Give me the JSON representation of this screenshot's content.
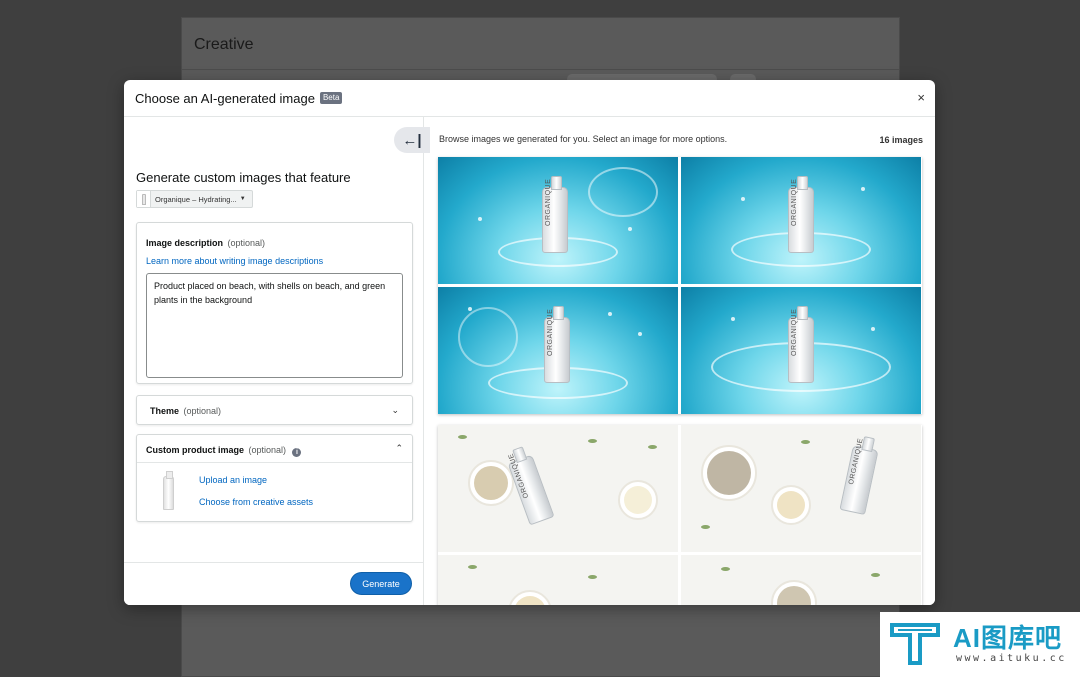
{
  "background": {
    "page_title": "Creative"
  },
  "modal": {
    "title": "Choose an AI-generated image",
    "badge": "Beta",
    "close_label": "×"
  },
  "left": {
    "collapse_label": "←|",
    "heading": "Generate custom images that feature",
    "product_select": "Organique – Hydrating...",
    "description": {
      "label": "Image description",
      "optional": "(optional)",
      "learn_more": "Learn more about writing image descriptions",
      "value": "Product placed on beach, with shells on beach, and green plants in the background"
    },
    "theme": {
      "label": "Theme",
      "optional": "(optional)"
    },
    "custom_product": {
      "label": "Custom product image",
      "optional": "(optional)",
      "upload": "Upload an image",
      "choose": "Choose from creative assets"
    },
    "generate_label": "Generate"
  },
  "right": {
    "browse_text": "Browse images we generated for you. Select an image for more options.",
    "count": "16 images",
    "brand_text": "ORGANIQUE"
  },
  "watermark": {
    "text": "AI图库吧",
    "url": "www.aituku.cc"
  },
  "colors": {
    "accent": "#1a73c9",
    "link": "#0066c0",
    "overlay": "#3f3f3f",
    "watermark": "#1a9bc5"
  },
  "icons": [
    "close-icon",
    "collapse-panel-icon",
    "chevron-down-icon",
    "chevron-up-icon",
    "info-icon"
  ]
}
